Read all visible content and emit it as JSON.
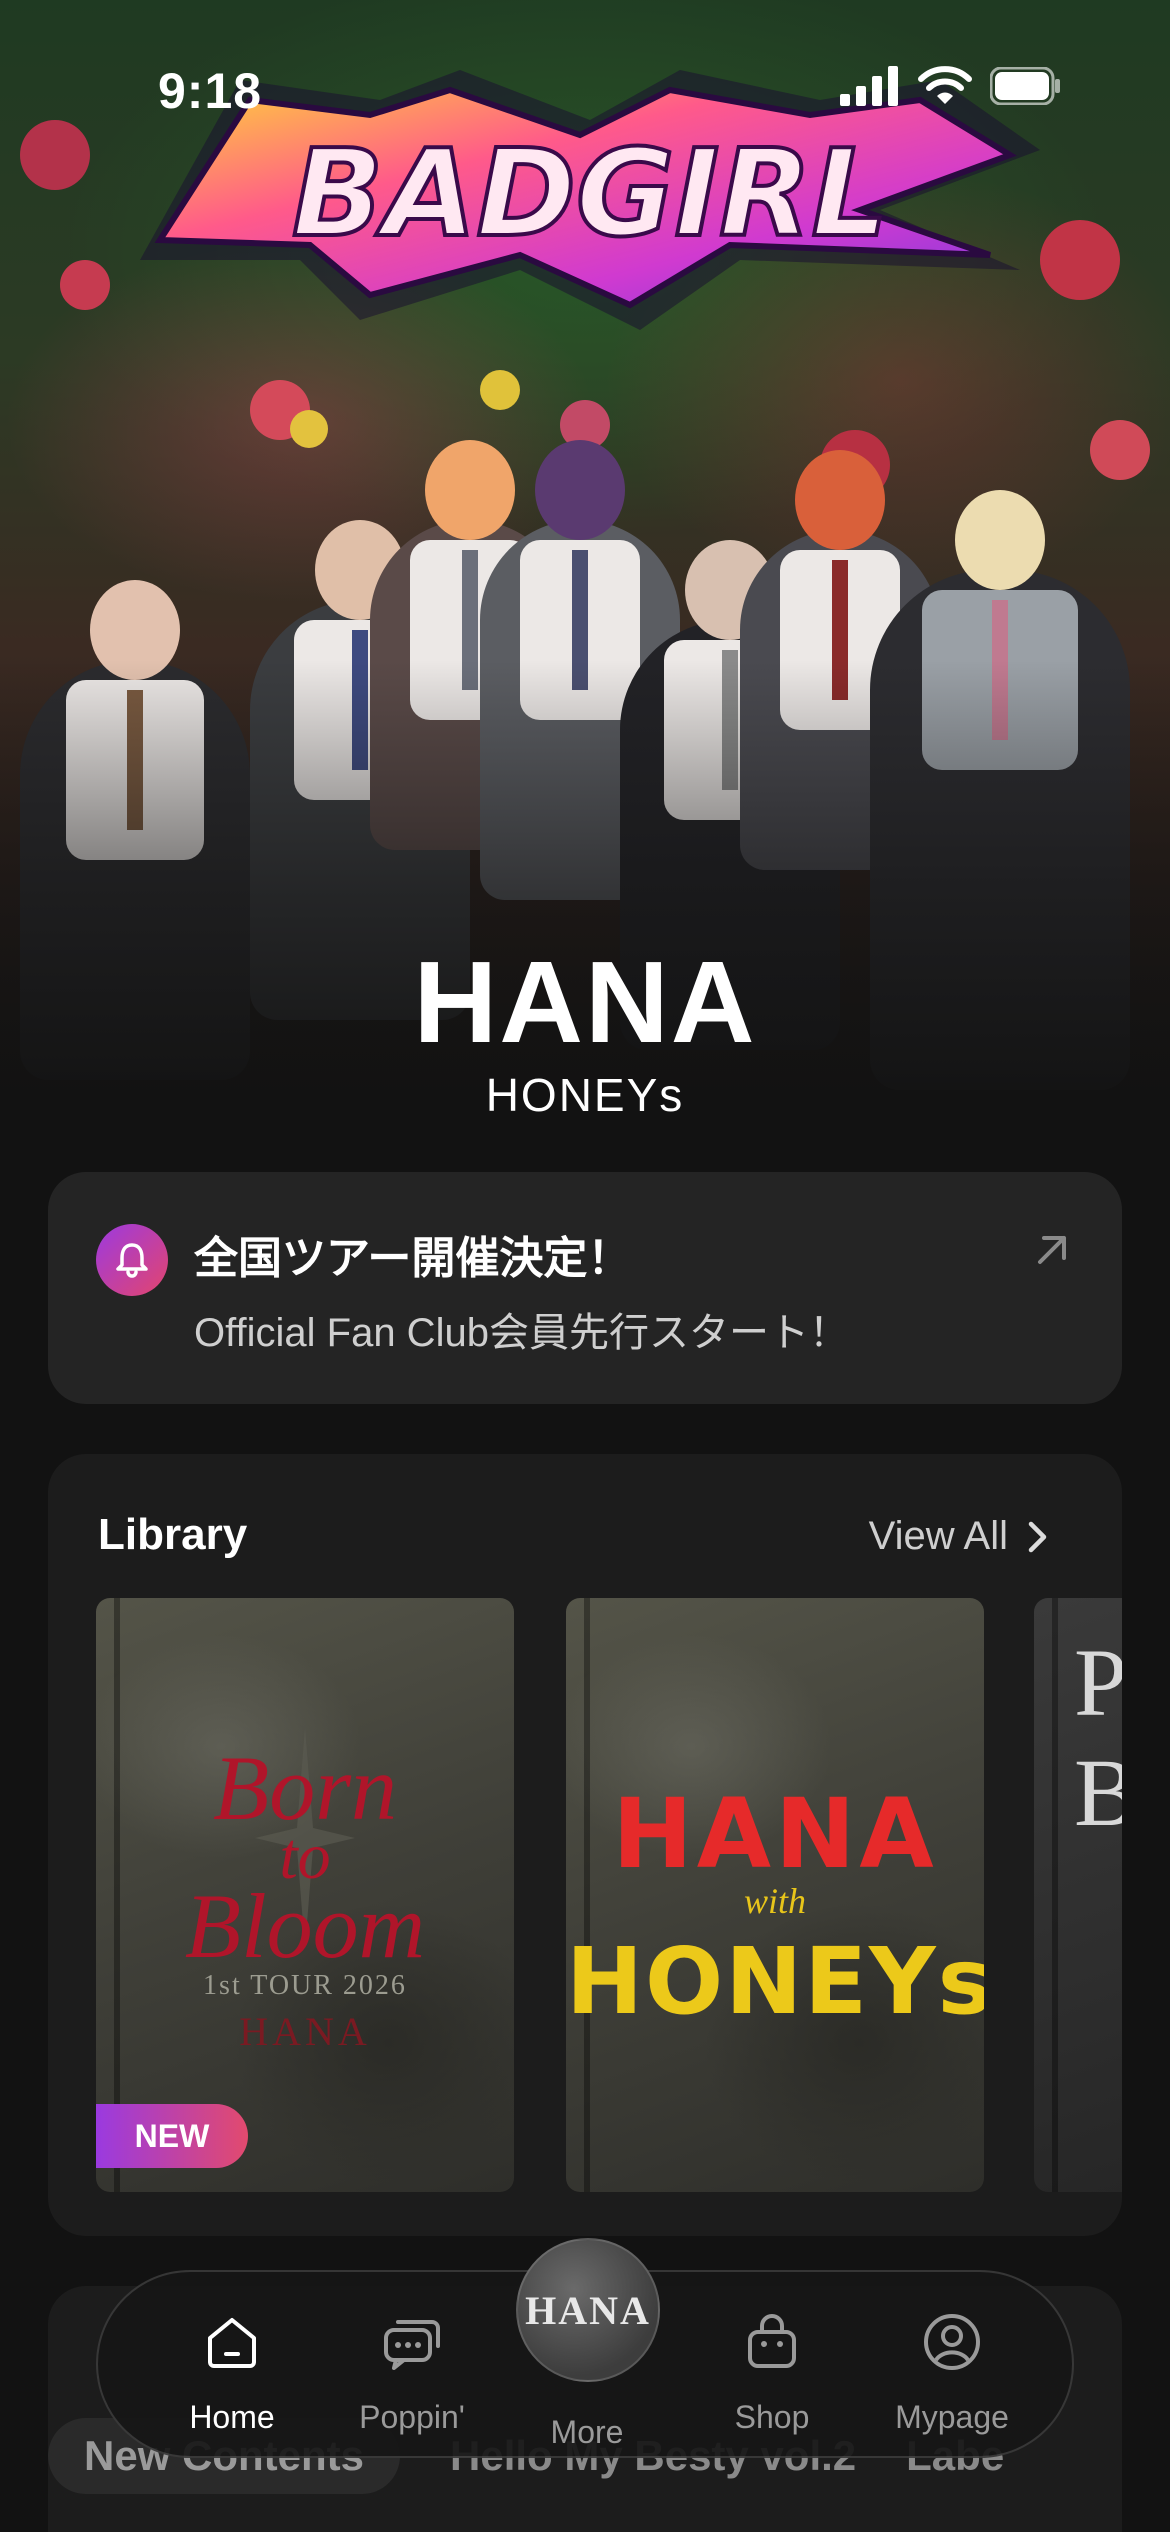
{
  "status_bar": {
    "time": "9:18"
  },
  "hero": {
    "graffiti_logo": "BADGIRL",
    "artist_name": "HANA",
    "artist_subtitle": "HONEYs"
  },
  "notice": {
    "title": "全国ツアー開催決定！",
    "subtitle": "Official Fan Club会員先行スタート！",
    "icon": "bell-icon",
    "arrow_icon": "arrow-up-right-icon"
  },
  "library": {
    "title": "Library",
    "view_all": "View All",
    "books": [
      {
        "line1": "Born",
        "line2": "to",
        "line3": "Bloom",
        "tour": "1st TOUR 2026",
        "artist": "HANA",
        "badge": "NEW"
      },
      {
        "top": "HANA",
        "mid": "with",
        "bottom": "HONEYs"
      },
      {
        "partial": "P B"
      }
    ]
  },
  "contents": {
    "chips": [
      "New Contents",
      "Hello My Besty vol.2",
      "Labe"
    ]
  },
  "tabbar": {
    "items": [
      {
        "label": "Home",
        "icon": "home-icon"
      },
      {
        "label": "Poppin'",
        "icon": "chat-bubbles-icon"
      },
      {
        "label": "More",
        "icon": "hana-logo"
      },
      {
        "label": "Shop",
        "icon": "shopping-bag-icon"
      },
      {
        "label": "Mypage",
        "icon": "user-circle-icon"
      }
    ],
    "more_logo_text": "HANA"
  },
  "colors": {
    "background": "#121212",
    "card": "#242424",
    "accent_start": "#9c3ae0",
    "accent_end": "#e3456d"
  }
}
